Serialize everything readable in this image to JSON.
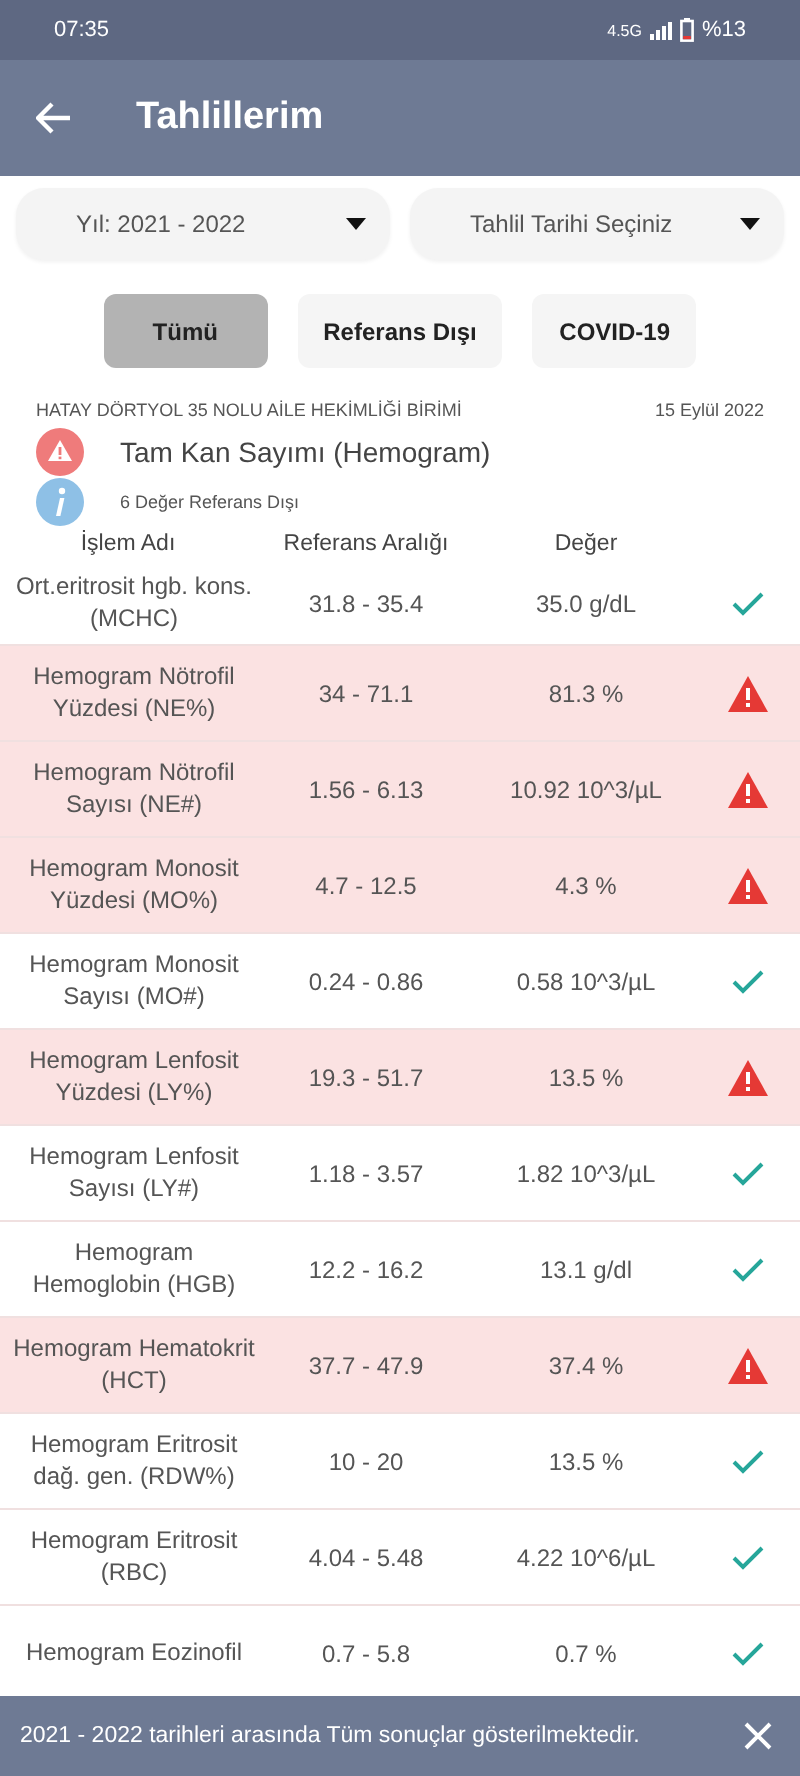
{
  "status_bar": {
    "time": "07:35",
    "network": "4.5G",
    "battery": "%13"
  },
  "app_bar": {
    "title": "Tahlillerim"
  },
  "dropdowns": [
    {
      "value": "Yıl: 2021 - 2022"
    },
    {
      "value": "Tahlil Tarihi Seçiniz"
    }
  ],
  "filters": [
    {
      "label": "Tümü",
      "selected": true
    },
    {
      "label": "Referans Dışı",
      "selected": false
    },
    {
      "label": "COVID-19",
      "selected": false
    }
  ],
  "report": {
    "institution": "HATAY DÖRTYOL 35  NOLU AİLE HEKİMLİĞİ BİRİMİ",
    "date": "15 Eylül 2022",
    "test_name": "Tam Kan Sayımı (Hemogram)",
    "note": "6 Değer Referans Dışı"
  },
  "table": {
    "columns": [
      "İşlem Adı",
      "Referans Aralığı",
      "Değer"
    ],
    "rows": [
      {
        "name": "Ort.eritrosit hgb. kons.(MCHC)",
        "range": "31.8 - 35.4",
        "value": "35.0 g/dL",
        "out_of_range": false
      },
      {
        "name": "Hemogram Nötrofil Yüzdesi (NE%)",
        "range": "34 - 71.1",
        "value": "81.3 %",
        "out_of_range": true
      },
      {
        "name": "Hemogram Nötrofil Sayısı (NE#)",
        "range": "1.56 - 6.13",
        "value": "10.92 10^3/µL",
        "out_of_range": true
      },
      {
        "name": "Hemogram Monosit Yüzdesi (MO%)",
        "range": "4.7 - 12.5",
        "value": "4.3 %",
        "out_of_range": true
      },
      {
        "name": "Hemogram Monosit Sayısı (MO#)",
        "range": "0.24 - 0.86",
        "value": "0.58 10^3/µL",
        "out_of_range": false
      },
      {
        "name": "Hemogram Lenfosit Yüzdesi (LY%)",
        "range": "19.3 - 51.7",
        "value": "13.5 %",
        "out_of_range": true
      },
      {
        "name": "Hemogram Lenfosit Sayısı (LY#)",
        "range": "1.18 - 3.57",
        "value": "1.82 10^3/µL",
        "out_of_range": false
      },
      {
        "name": "Hemogram Hemoglobin (HGB)",
        "range": "12.2 - 16.2",
        "value": "13.1 g/dl",
        "out_of_range": false
      },
      {
        "name": "Hemogram Hematokrit (HCT)",
        "range": "37.7 - 47.9",
        "value": "37.4 %",
        "out_of_range": true
      },
      {
        "name": "Hemogram Eritrosit dağ. gen. (RDW%)",
        "range": "10 - 20",
        "value": "13.5 %",
        "out_of_range": false
      },
      {
        "name": "Hemogram Eritrosit (RBC)",
        "range": "4.04 - 5.48",
        "value": "4.22 10^6/µL",
        "out_of_range": false
      },
      {
        "name": "Hemogram Eozinofil",
        "range": "0.7 - 5.8",
        "value": "0.7 %",
        "out_of_range": false
      }
    ]
  },
  "snackbar": {
    "message": "2021 - 2022 tarihleri arasında Tüm sonuçlar gösterilmektedir."
  }
}
